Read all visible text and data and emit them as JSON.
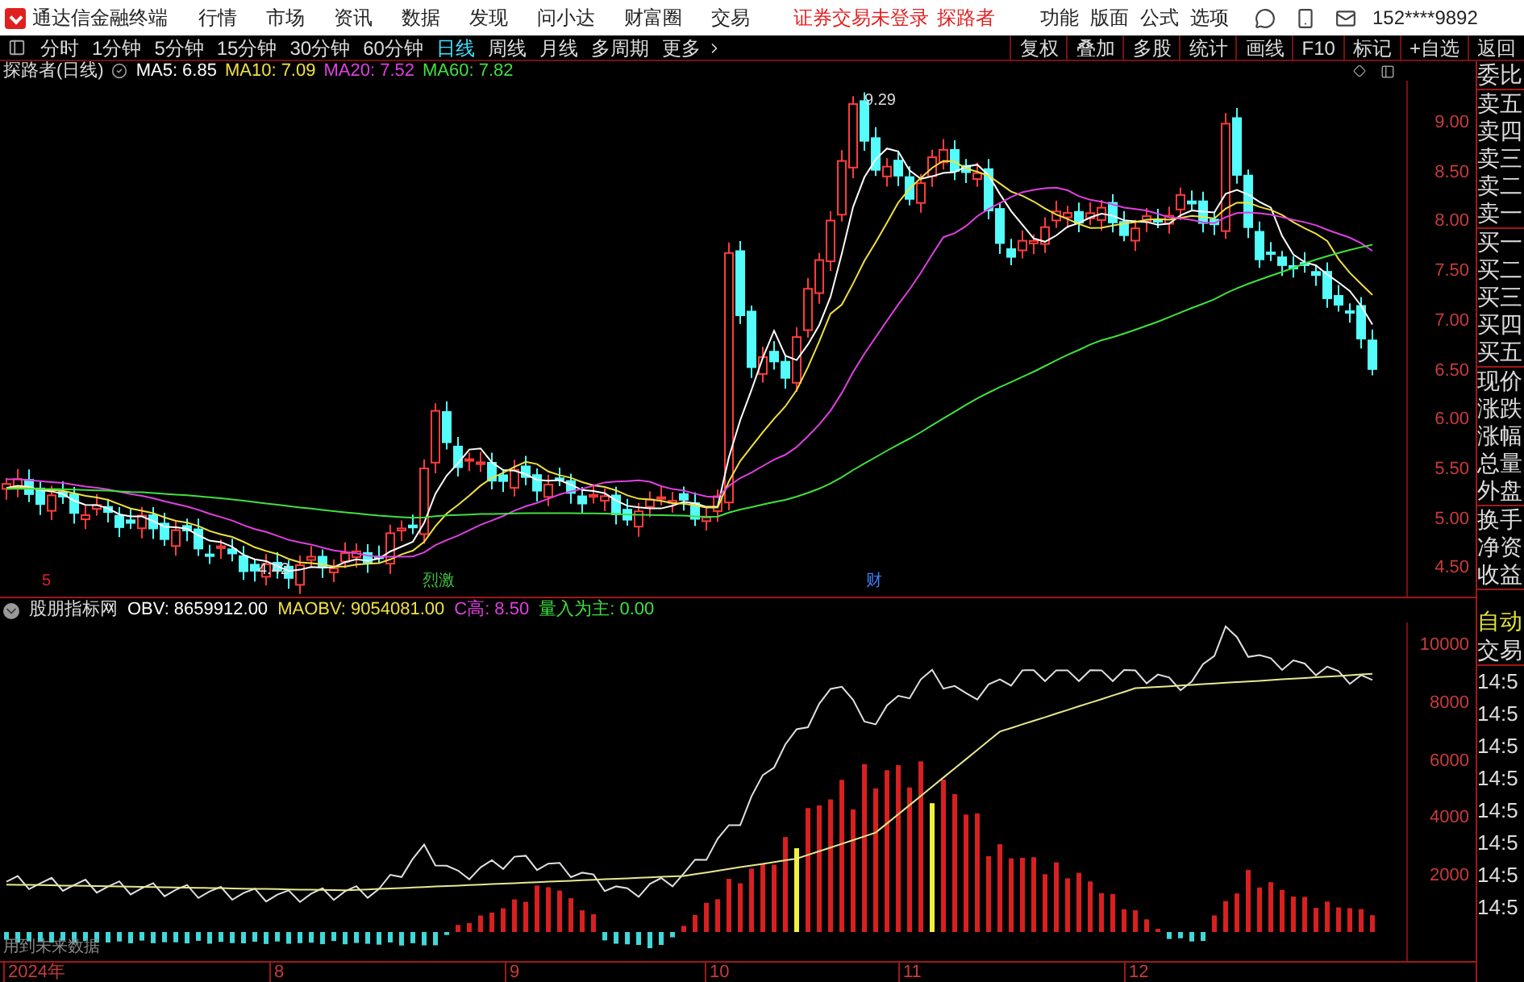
{
  "title_bar": {
    "app_name": "通达信金融终端",
    "menu": [
      "行情",
      "市场",
      "资讯",
      "数据",
      "发现",
      "问小达",
      "财富圈",
      "交易"
    ],
    "notice": "证券交易未登录",
    "user_label": "探路者",
    "right_menu": [
      "功能",
      "版面",
      "公式",
      "选项"
    ],
    "account": "152****9892"
  },
  "toolbar": {
    "periods": [
      {
        "label": "分时",
        "selected": false
      },
      {
        "label": "1分钟",
        "selected": false
      },
      {
        "label": "5分钟",
        "selected": false
      },
      {
        "label": "15分钟",
        "selected": false
      },
      {
        "label": "30分钟",
        "selected": false
      },
      {
        "label": "60分钟",
        "selected": false
      },
      {
        "label": "日线",
        "selected": true
      },
      {
        "label": "周线",
        "selected": false
      },
      {
        "label": "月线",
        "selected": false
      },
      {
        "label": "多周期",
        "selected": false
      },
      {
        "label": "更多",
        "selected": false
      }
    ],
    "buttons": [
      "复权",
      "叠加",
      "多股",
      "统计",
      "画线",
      "F10",
      "标记",
      "+自选",
      "返回"
    ]
  },
  "price_panel": {
    "title": "探路者(日线)",
    "indicators": [
      {
        "label": "MA5: 6.85",
        "color": "#ffffff"
      },
      {
        "label": "MA10: 7.09",
        "color": "#f0e040"
      },
      {
        "label": "MA20: 7.52",
        "color": "#e040e0"
      },
      {
        "label": "MA60: 7.82",
        "color": "#40e040"
      }
    ],
    "y_axis_labels": [
      "9.00",
      "8.50",
      "8.00",
      "7.50",
      "7.00",
      "6.50",
      "6.00",
      "5.50",
      "5.00",
      "4.50"
    ],
    "annotations": [
      {
        "label": "9.29",
        "kind": "high"
      },
      {
        "label": "4.42",
        "kind": "low"
      }
    ],
    "event_marks": [
      {
        "label": "5",
        "color": "#e02020"
      },
      {
        "label": "烈激",
        "color": "#40c040"
      },
      {
        "label": "财",
        "color": "#4080ff"
      }
    ]
  },
  "indicator_panel": {
    "title": "股朋指标网",
    "indicators": [
      {
        "label": "OBV: 8659912.00",
        "color": "#ffffff"
      },
      {
        "label": "MAOBV: 9054081.00",
        "color": "#f0e040"
      },
      {
        "label": "C高: 8.50",
        "color": "#e040e0"
      },
      {
        "label": "量入为主: 0.00",
        "color": "#40e040"
      }
    ],
    "y_axis_labels": [
      "10000",
      "8000",
      "6000",
      "4000",
      "2000"
    ],
    "note": "用到未来数据"
  },
  "time_axis": [
    "2024年",
    "8",
    "9",
    "10",
    "11",
    "12"
  ],
  "quote_panel": {
    "groups": [
      [
        "委比"
      ],
      [
        "卖五",
        "卖四",
        "卖三",
        "卖二",
        "卖一"
      ],
      [
        "买一",
        "买二",
        "买三",
        "买四",
        "买五"
      ],
      [
        "现价",
        "涨跌",
        "涨幅",
        "总量",
        "外盘"
      ],
      [
        "换手",
        "净资",
        "收益"
      ]
    ],
    "status": "自动",
    "column_header": "交易",
    "times": [
      "14:5",
      "14:5",
      "14:5",
      "14:5",
      "14:5",
      "14:5",
      "14:5",
      "14:5"
    ]
  }
}
